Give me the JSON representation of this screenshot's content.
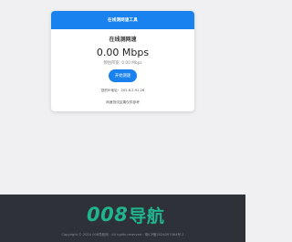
{
  "card": {
    "header_title": "在线测网速工具",
    "title": "在线测网速",
    "speed": "0.00 Mbps",
    "avg_speed": "预估带宽: 0.00 Mbps",
    "start_button": "开始测速",
    "ip": "您的IP地址：202.8.2.91.26",
    "note": "网速测试结果仅供参考"
  },
  "footer": {
    "logo_digits": "008",
    "logo_text": "导航",
    "copyright": "Copyright © 2024 008导航网 · All rights reserved ·",
    "icp": "粤ICP备2024097064号-1"
  },
  "colors": {
    "accent": "#1a82ee",
    "logo": "#1fb58f",
    "footer_bg": "#2e3238",
    "page_bg": "#f0f0f2"
  }
}
